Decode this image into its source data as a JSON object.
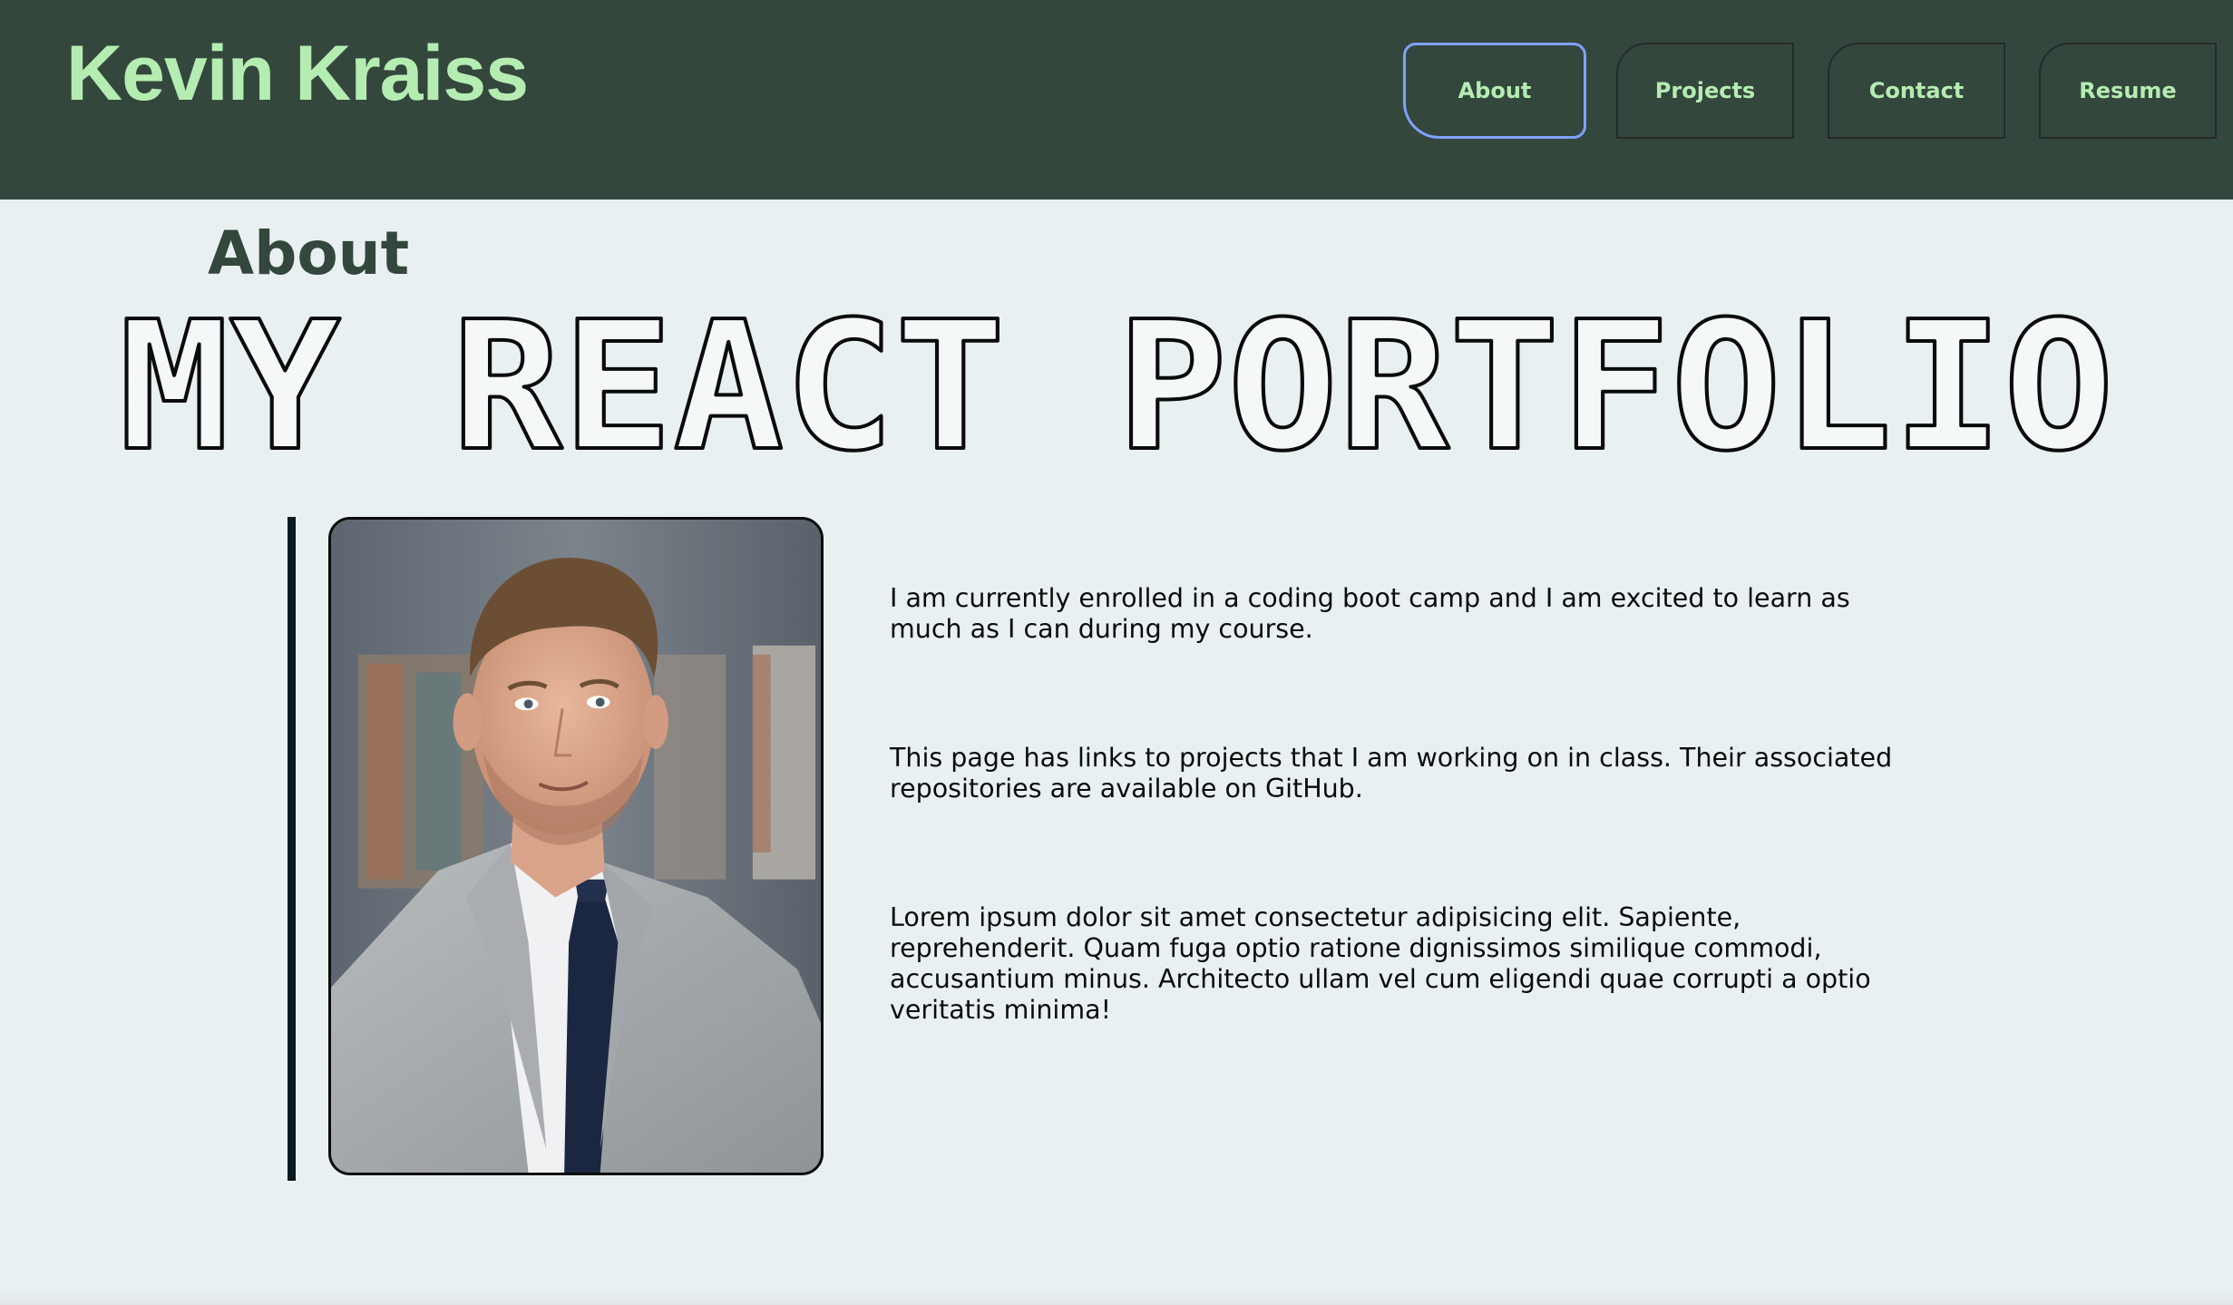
{
  "header": {
    "brand": "Kevin Kraiss",
    "nav": [
      {
        "label": "About",
        "active": true
      },
      {
        "label": "Projects",
        "active": false
      },
      {
        "label": "Contact",
        "active": false
      },
      {
        "label": "Resume",
        "active": false
      }
    ]
  },
  "main": {
    "section_title": "About",
    "hero_title": "MY REACT PORTFOLIO",
    "photo_alt": "profile-photo",
    "paragraphs": [
      "I am currently enrolled in a coding boot camp and I am excited to learn as much as I can during my course.",
      "This page has links to projects that I am working on in class. Their associated repositories are available on GitHub.",
      "Lorem ipsum dolor sit amet consectetur adipisicing elit. Sapiente, reprehenderit. Quam fuga optio ratione dignissimos similique commodi, accusantium minus. Architecto ullam vel cum eligendi quae corrupti a optio veritatis minima!"
    ]
  },
  "colors": {
    "header_bg": "#34473d",
    "brand_green": "#b5ecb2",
    "page_bg": "#e9f0f2",
    "active_outline": "#7fa1ff"
  }
}
